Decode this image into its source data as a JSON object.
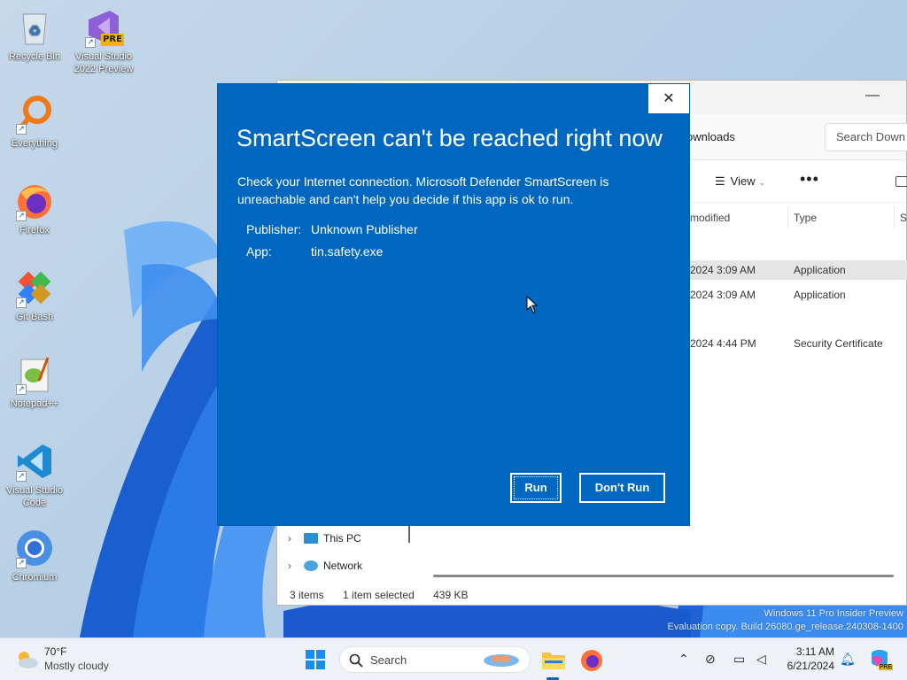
{
  "desktop": {
    "icons": [
      {
        "label": "Recycle Bin"
      },
      {
        "label": "Visual Studio 2022 Preview",
        "badge": "PRE"
      },
      {
        "label": "Everything"
      },
      {
        "label": "Firefox"
      },
      {
        "label": "Git Bash"
      },
      {
        "label": "Notepad++"
      },
      {
        "label": "Visual Studio Code"
      },
      {
        "label": "Chromium"
      }
    ]
  },
  "explorer": {
    "address": "ownloads",
    "search_placeholder": "Search Down",
    "view_label": "View",
    "more_label": "•••",
    "columns": {
      "modified": "modified",
      "type": "Type",
      "size": "Si"
    },
    "rows": [
      {
        "modified": "2024 3:09 AM",
        "type": "Application",
        "selected": true
      },
      {
        "modified": "2024 3:09 AM",
        "type": "Application",
        "selected": false
      },
      {
        "modified": "2024 4:44 PM",
        "type": "Security Certificate",
        "selected": false
      }
    ],
    "nav": [
      {
        "label": "This PC"
      },
      {
        "label": "Network"
      }
    ],
    "status": {
      "items": "3 items",
      "selected": "1 item selected",
      "size": "439 KB"
    }
  },
  "dialog": {
    "title": "SmartScreen can't be reached right now",
    "message": "Check your Internet connection. Microsoft Defender SmartScreen is unreachable and can't help you decide if this app is ok to run.",
    "publisher_key": "Publisher:",
    "publisher_value": "Unknown Publisher",
    "app_key": "App:",
    "app_value": "tin.safety.exe",
    "run_label": "Run",
    "dont_run_label": "Don't Run",
    "close_label": "✕",
    "color": "#0067c0"
  },
  "watermark": {
    "line1": "Windows 11 Pro Insider Preview",
    "line2": "Evaluation copy. Build 26080.ge_release.240308-1400"
  },
  "taskbar": {
    "weather_temp": "70°F",
    "weather_cond": "Mostly cloudy",
    "search_label": "Search",
    "time": "3:11 AM",
    "date": "6/21/2024",
    "pre_badge": "PRE"
  }
}
